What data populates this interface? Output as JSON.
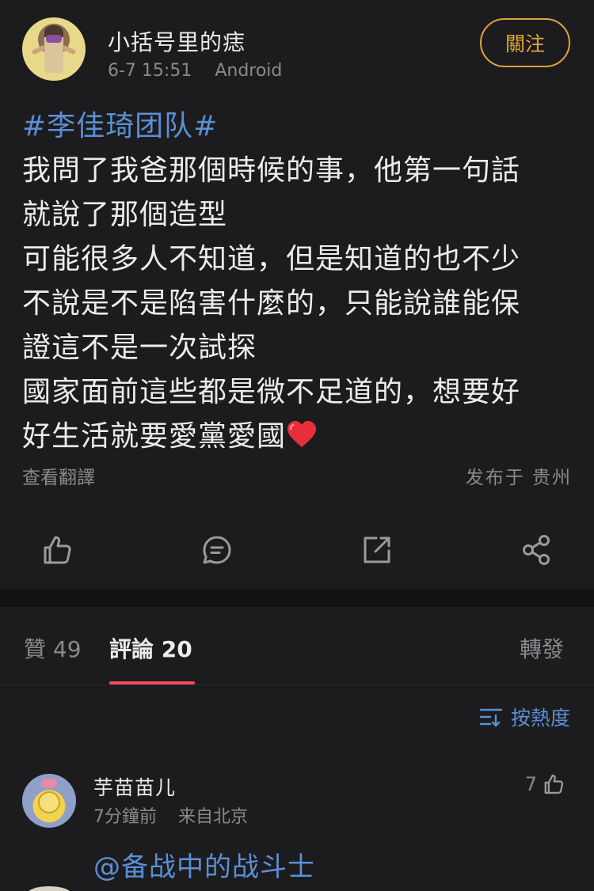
{
  "post": {
    "username": "小括号里的痣",
    "time": "6-7 15:51",
    "device": "Android",
    "follow_label": "關注",
    "hashtag": "#李佳琦团队#",
    "lines": [
      "我問了我爸那個時候的事，他第一句話",
      "就說了那個造型",
      "可能很多人不知道，但是知道的也不少",
      "不說是不是陷害什麼的，只能說誰能保",
      "證這不是一次試探",
      "國家面前這些都是微不足道的，想要好",
      "好生活就要愛黨愛國"
    ],
    "emoji": "heart-emoji",
    "translate_label": "查看翻譯",
    "location": "发布于 贵州"
  },
  "actions": {
    "like_icon": "thumbs-up-icon",
    "comment_icon": "comment-bubble-icon",
    "repost_icon": "repost-icon",
    "share_icon": "share-icon"
  },
  "tabs": {
    "likes": "贊 49",
    "comments": "評論 20",
    "reposts": "轉發"
  },
  "sort": {
    "label": "按熱度",
    "icon": "sort-icon"
  },
  "comments": [
    {
      "name": "芋苗苗儿",
      "time": "7分鐘前",
      "location": "来自北京",
      "likes": "7",
      "text": "@备战中的战斗士"
    }
  ],
  "colors": {
    "background": "#1c1c1e",
    "accent_blue": "#5b8fd6",
    "follow_orange": "#e0a43b",
    "tab_underline": "#e8505b"
  }
}
